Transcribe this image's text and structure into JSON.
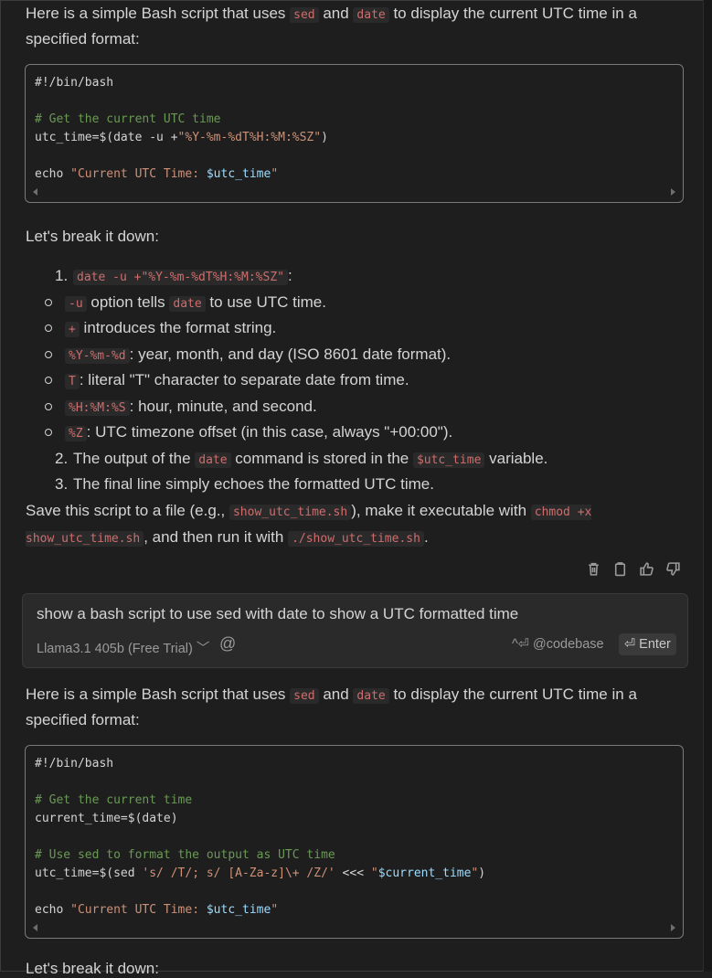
{
  "response1": {
    "intro": {
      "before": "Here is a simple Bash script that uses ",
      "code1": "sed",
      "mid": " and ",
      "code2": "date",
      "after": " to display the current UTC time in a specified format:"
    },
    "code": {
      "shebang": "#!/bin/bash",
      "comment": "# Get the current UTC time",
      "line_utc_a": "utc_time=$(date -u +",
      "line_utc_str": "\"%Y-%m-%dT%H:%M:%SZ\"",
      "line_utc_b": ")",
      "echo_a": "echo ",
      "echo_str": "\"Current UTC Time: ",
      "echo_var": "$utc_time",
      "echo_end": "\""
    },
    "breakdown_heading": "Let's break it down:",
    "items": [
      {
        "num": "1.",
        "code": "date -u +\"%Y-%m-%dT%H:%M:%SZ\"",
        "text": ":"
      },
      {
        "num": "2.",
        "before": "The output of the ",
        "code1": "date",
        "mid": " command is stored in the ",
        "code2": "$utc_time",
        "after": " variable."
      },
      {
        "num": "3.",
        "text": "The final line simply echoes the formatted UTC time."
      }
    ],
    "subitems": [
      {
        "code": "-u",
        "before": " option tells ",
        "code2": "date",
        "after": " to use UTC time."
      },
      {
        "code": "+",
        "text": " introduces the format string."
      },
      {
        "code": "%Y-%m-%d",
        "text": ": year, month, and day (ISO 8601 date format)."
      },
      {
        "code": "T",
        "text": ": literal \"T\" character to separate date from time."
      },
      {
        "code": "%H:%M:%S",
        "text": ": hour, minute, and second."
      },
      {
        "code": "%Z",
        "text": ": UTC timezone offset (in this case, always \"+00:00\")."
      }
    ],
    "save": {
      "a": "Save this script to a file (e.g., ",
      "code1": "show_utc_time.sh",
      "b": "), make it executable with ",
      "code2": "chmod +x show_utc_time.sh",
      "c": ", and then run it with ",
      "code3": "./show_utc_time.sh",
      "d": "."
    }
  },
  "input": {
    "prompt": "show a bash script to use sed with date to show a UTC formatted time",
    "model": "Llama3.1 405b (Free Trial)",
    "at": "@",
    "codebase": "^⏎ @codebase",
    "enter": "⏎ Enter"
  },
  "response2": {
    "intro": {
      "before": "Here is a simple Bash script that uses ",
      "code1": "sed",
      "mid": " and ",
      "code2": "date",
      "after": " to display the current UTC time in a specified format:"
    },
    "code": {
      "shebang": "#!/bin/bash",
      "comment1": "# Get the current time",
      "line_cur": "current_time=$(date)",
      "comment2": "# Use sed to format the output as UTC time",
      "sed_a": "utc_time=$(sed ",
      "sed_str": "'s/ /T/; s/ [A-Za-z]\\+ /Z/'",
      "sed_b": " <<< ",
      "sed_q1": "\"",
      "sed_var": "$current_time",
      "sed_q2": "\"",
      "sed_c": ")",
      "echo_a": "echo ",
      "echo_str": "\"Current UTC Time: ",
      "echo_var": "$utc_time",
      "echo_end": "\""
    },
    "partial": "Let's break it down:"
  }
}
